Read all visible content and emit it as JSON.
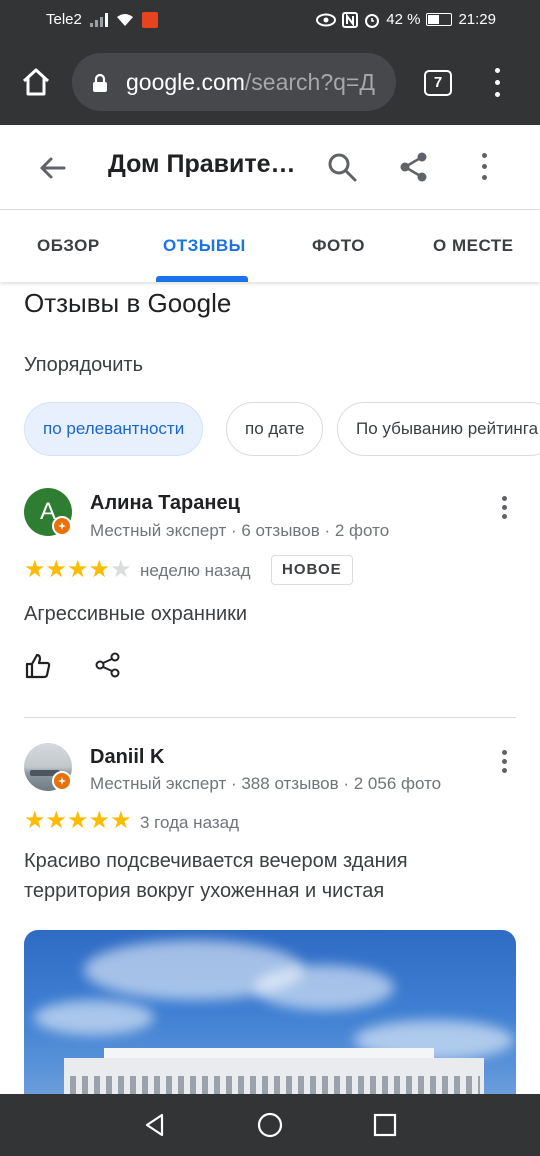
{
  "status_bar": {
    "carrier": "Tele2",
    "battery": "42 %",
    "time": "21:29",
    "notification_color": "#e8431f"
  },
  "browser": {
    "url_main": "google.com",
    "url_rest": "/search?q=Д",
    "tab_count": "7"
  },
  "header": {
    "title": "Дом Правите…"
  },
  "tabs": [
    {
      "label": "ОБЗОР"
    },
    {
      "label": "ОТЗЫВЫ",
      "active": true
    },
    {
      "label": "ФОТО"
    },
    {
      "label": "О МЕСТЕ"
    }
  ],
  "reviews_section": {
    "title": "Отзывы в Google",
    "sort_label": "Упорядочить",
    "chips": [
      "по релевантности",
      "по дате",
      "По убыванию рейтинга"
    ]
  },
  "reviews": [
    {
      "author": "Алина Таранец",
      "avatar_letter": "А",
      "meta": "Местный эксперт · 6 отзывов · 2 фото",
      "rating": 4,
      "date": "неделю назад",
      "badge": "НОВОЕ",
      "text": "Агрессивные охранники"
    },
    {
      "author": "Daniil K",
      "meta": "Местный эксперт · 388 отзывов · 2 056 фото",
      "rating": 5,
      "date": "3 года назад",
      "text_line1": "Красиво подсвечивается вечером здания",
      "text_line2": "территория вокруг ухоженная и чистая"
    }
  ],
  "colors": {
    "accent": "#1a73e8",
    "star": "#fbbc04",
    "avatar_green": "#2e7d32",
    "expert_badge": "#e8710a"
  },
  "icons": [
    "home-icon",
    "lock-icon",
    "back-arrow-icon",
    "search-icon",
    "share-icon",
    "more-vert-icon",
    "thumb-up-icon",
    "nav-back-icon",
    "nav-home-icon",
    "nav-recents-icon"
  ]
}
